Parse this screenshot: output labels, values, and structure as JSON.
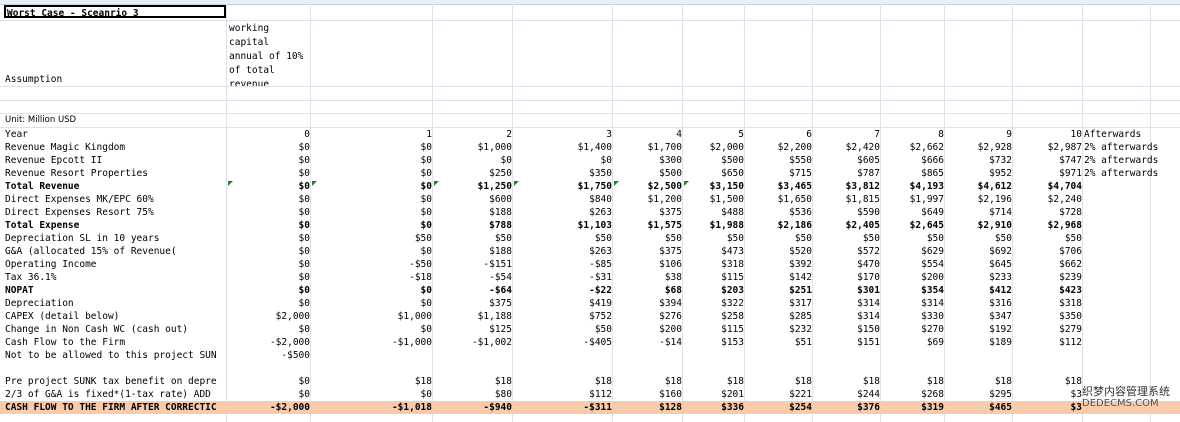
{
  "title": "Worst Case - Sceanrio 3",
  "wc_note": "working\ncapital\nannual of 10%\nof total\nrevenue",
  "assumption": "Assumption",
  "unit": "Unit: Million USD",
  "rows": [
    {
      "label": "Year",
      "vals": [
        "0",
        "1",
        "2",
        "3",
        "4",
        "5",
        "6",
        "7",
        "8",
        "9",
        "10"
      ],
      "ext": "Afterwards"
    },
    {
      "label": "Revenue Magic Kingdom",
      "vals": [
        "$0",
        "$0",
        "$1,000",
        "$1,400",
        "$1,700",
        "$2,000",
        "$2,200",
        "$2,420",
        "$2,662",
        "$2,928",
        "$2,987"
      ],
      "ext": "2% afterwards"
    },
    {
      "label": "Revenue Epcott II",
      "vals": [
        "$0",
        "$0",
        "$0",
        "$0",
        "$300",
        "$500",
        "$550",
        "$605",
        "$666",
        "$732",
        "$747"
      ],
      "ext": "2% afterwards"
    },
    {
      "label": "Revenue Resort Properties",
      "vals": [
        "$0",
        "$0",
        "$250",
        "$350",
        "$500",
        "$650",
        "$715",
        "$787",
        "$865",
        "$952",
        "$971"
      ],
      "ext": "2% afterwards"
    },
    {
      "label": "Total Revenue",
      "vals": [
        "$0",
        "$0",
        "$1,250",
        "$1,750",
        "$2,500",
        "$3,150",
        "$3,465",
        "$3,812",
        "$4,193",
        "$4,612",
        "$4,704"
      ],
      "ext": "",
      "bold": true
    },
    {
      "label": "Direct Expenses MK/EPC 60%",
      "vals": [
        "$0",
        "$0",
        "$600",
        "$840",
        "$1,200",
        "$1,500",
        "$1,650",
        "$1,815",
        "$1,997",
        "$2,196",
        "$2,240"
      ],
      "ext": ""
    },
    {
      "label": "Direct Expenses Resort 75%",
      "vals": [
        "$0",
        "$0",
        "$188",
        "$263",
        "$375",
        "$488",
        "$536",
        "$590",
        "$649",
        "$714",
        "$728"
      ],
      "ext": ""
    },
    {
      "label": "Total Expense",
      "vals": [
        "$0",
        "$0",
        "$788",
        "$1,103",
        "$1,575",
        "$1,988",
        "$2,186",
        "$2,405",
        "$2,645",
        "$2,910",
        "$2,968"
      ],
      "ext": "",
      "bold": true
    },
    {
      "label": "Depreciation SL in 10 years",
      "vals": [
        "$0",
        "$50",
        "$50",
        "$50",
        "$50",
        "$50",
        "$50",
        "$50",
        "$50",
        "$50",
        "$50"
      ],
      "ext": ""
    },
    {
      "label": "G&A (allocated 15% of Revenue(",
      "vals": [
        "$0",
        "$0",
        "$188",
        "$263",
        "$375",
        "$473",
        "$520",
        "$572",
        "$629",
        "$692",
        "$706"
      ],
      "ext": ""
    },
    {
      "label": "Operating Income",
      "vals": [
        "$0",
        "-$50",
        "-$151",
        "-$85",
        "$106",
        "$318",
        "$392",
        "$470",
        "$554",
        "$645",
        "$662"
      ],
      "ext": ""
    },
    {
      "label": "Tax 36.1%",
      "vals": [
        "$0",
        "-$18",
        "-$54",
        "-$31",
        "$38",
        "$115",
        "$142",
        "$170",
        "$200",
        "$233",
        "$239"
      ],
      "ext": ""
    },
    {
      "label": "NOPAT",
      "vals": [
        "$0",
        "$0",
        "-$64",
        "-$22",
        "$68",
        "$203",
        "$251",
        "$301",
        "$354",
        "$412",
        "$423"
      ],
      "ext": "",
      "bold": true
    },
    {
      "label": "Depreciation",
      "vals": [
        "$0",
        "$0",
        "$375",
        "$419",
        "$394",
        "$322",
        "$317",
        "$314",
        "$314",
        "$316",
        "$318"
      ],
      "ext": ""
    },
    {
      "label": "CAPEX (detail below)",
      "vals": [
        "$2,000",
        "$1,000",
        "$1,188",
        "$752",
        "$276",
        "$258",
        "$285",
        "$314",
        "$330",
        "$347",
        "$350"
      ],
      "ext": ""
    },
    {
      "label": "Change in Non Cash WC (cash out)",
      "vals": [
        "$0",
        "$0",
        "$125",
        "$50",
        "$200",
        "$115",
        "$232",
        "$150",
        "$270",
        "$192",
        "$279"
      ],
      "ext": ""
    },
    {
      "label": "Cash Flow to the Firm",
      "vals": [
        "-$2,000",
        "-$1,000",
        "-$1,002",
        "-$405",
        "-$14",
        "$153",
        "$51",
        "$151",
        "$69",
        "$189",
        "$112"
      ],
      "ext": ""
    },
    {
      "label": "Not to be allowed to this project SUN",
      "vals": [
        "-$500",
        "",
        "",
        "",
        "",
        "",
        "",
        "",
        "",
        "",
        ""
      ],
      "ext": ""
    },
    {
      "label": "",
      "vals": [
        "",
        "",
        "",
        "",
        "",
        "",
        "",
        "",
        "",
        "",
        ""
      ],
      "ext": ""
    },
    {
      "label": "Pre project SUNK tax benefit on depre",
      "vals": [
        "$0",
        "$18",
        "$18",
        "$18",
        "$18",
        "$18",
        "$18",
        "$18",
        "$18",
        "$18",
        "$18"
      ],
      "ext": ""
    },
    {
      "label": "2/3 of G&A is fixed*(1-tax rate) ADD",
      "vals": [
        "$0",
        "$0",
        "$80",
        "$112",
        "$160",
        "$201",
        "$221",
        "$244",
        "$268",
        "$295",
        "$3"
      ],
      "ext": ""
    },
    {
      "label": "CASH FLOW TO THE FIRM AFTER CORRECTIC",
      "vals": [
        "-$2,000",
        "-$1,018",
        "-$940",
        "-$311",
        "$128",
        "$336",
        "$254",
        "$376",
        "$319",
        "$465",
        "$3"
      ],
      "ext": "",
      "bold": true,
      "highlight": true
    }
  ],
  "watermark": {
    "line1": "织梦内容管理系统",
    "line2": "DEDECMS.COM"
  }
}
